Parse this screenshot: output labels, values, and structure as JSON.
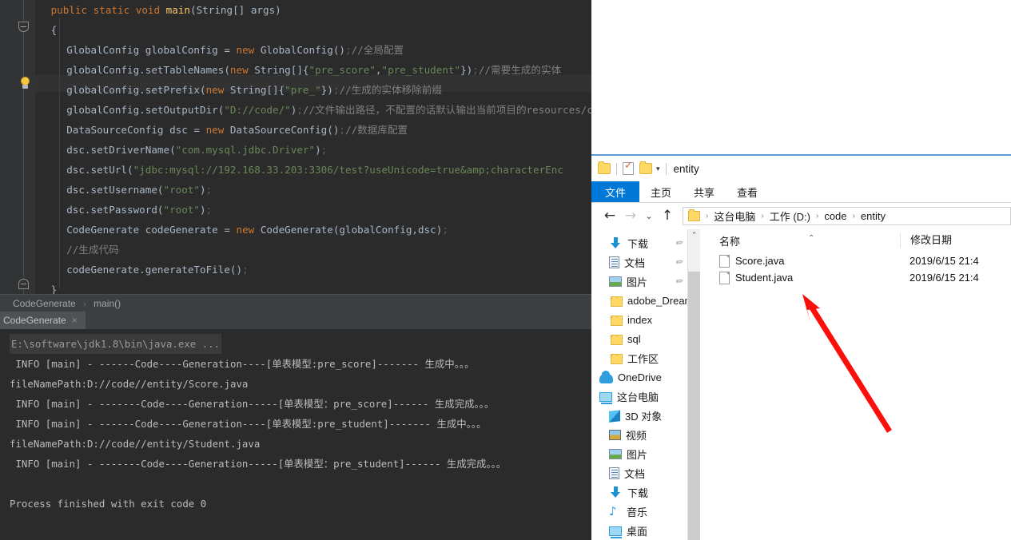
{
  "ide": {
    "code_lines": [
      [
        {
          "t": "kw",
          "s": "public static void "
        },
        {
          "t": "fn",
          "s": "main"
        },
        {
          "t": "pun",
          "s": "(String[] args)"
        }
      ],
      [
        {
          "t": "pun",
          "s": "{"
        }
      ],
      [
        {
          "t": "txt",
          "s": "GlobalConfig globalConfig = "
        },
        {
          "t": "kw",
          "s": "new "
        },
        {
          "t": "txt",
          "s": "GlobalConfig()"
        },
        {
          "t": "sem",
          "s": ";"
        },
        {
          "t": "cmt",
          "s": "//全局配置"
        }
      ],
      [
        {
          "t": "txt",
          "s": "globalConfig.setTableNames("
        },
        {
          "t": "kw",
          "s": "new "
        },
        {
          "t": "txt",
          "s": "String[]{"
        },
        {
          "t": "str",
          "s": "\"pre_score\""
        },
        {
          "t": "txt",
          "s": ","
        },
        {
          "t": "str",
          "s": "\"pre_student\""
        },
        {
          "t": "txt",
          "s": "})"
        },
        {
          "t": "sem",
          "s": ";"
        },
        {
          "t": "cmt",
          "s": "//需要生成的实体"
        }
      ],
      [
        {
          "t": "txt",
          "s": "globalConfig.setPrefix("
        },
        {
          "t": "kw",
          "s": "new "
        },
        {
          "t": "txt",
          "s": "String[]{"
        },
        {
          "t": "str",
          "s": "\"pre_\""
        },
        {
          "t": "txt",
          "s": "})"
        },
        {
          "t": "sem",
          "s": ";"
        },
        {
          "t": "cmt",
          "s": "//生成的实体移除前缀"
        }
      ],
      [
        {
          "t": "txt",
          "s": "globalConfig.setOutputDir("
        },
        {
          "t": "str",
          "s": "\"D://code/\""
        },
        {
          "t": "txt",
          "s": ")"
        },
        {
          "t": "sem",
          "s": ";"
        },
        {
          "t": "cmt",
          "s": "//文件输出路径，不配置的话默认输出当前项目的resources/code目录下"
        }
      ],
      [
        {
          "t": "txt",
          "s": "DataSourceConfig dsc = "
        },
        {
          "t": "kw",
          "s": "new "
        },
        {
          "t": "txt",
          "s": "DataSourceConfig()"
        },
        {
          "t": "sem",
          "s": ";"
        },
        {
          "t": "cmt",
          "s": "//数据库配置"
        }
      ],
      [
        {
          "t": "txt",
          "s": "dsc.setDriverName("
        },
        {
          "t": "str",
          "s": "\"com.mysql.jdbc.Driver\""
        },
        {
          "t": "txt",
          "s": ")"
        },
        {
          "t": "sem",
          "s": ";"
        }
      ],
      [
        {
          "t": "txt",
          "s": "dsc.setUrl("
        },
        {
          "t": "str",
          "s": "\"jdbc:mysql://192.168.33.203:3306/test?useUnicode=true&amp;characterEnc"
        }
      ],
      [
        {
          "t": "txt",
          "s": "dsc.setUsername("
        },
        {
          "t": "str",
          "s": "\"root\""
        },
        {
          "t": "txt",
          "s": ")"
        },
        {
          "t": "sem",
          "s": ";"
        }
      ],
      [
        {
          "t": "txt",
          "s": "dsc.setPassword("
        },
        {
          "t": "str",
          "s": "\"root\""
        },
        {
          "t": "txt",
          "s": ")"
        },
        {
          "t": "sem",
          "s": ";"
        }
      ],
      [
        {
          "t": "txt",
          "s": "CodeGenerate codeGenerate = "
        },
        {
          "t": "kw",
          "s": "new "
        },
        {
          "t": "txt",
          "s": "CodeGenerate(globalConfig,dsc)"
        },
        {
          "t": "sem",
          "s": ";"
        }
      ],
      [
        {
          "t": "cmt",
          "s": "//生成代码"
        }
      ],
      [
        {
          "t": "txt",
          "s": "codeGenerate.generateToFile()"
        },
        {
          "t": "sem",
          "s": ";"
        }
      ],
      [
        {
          "t": "pun",
          "s": "}"
        }
      ]
    ],
    "breadcrumb": {
      "class_name": "CodeGenerate",
      "separator": "›",
      "method_name": "main()"
    },
    "console_tab": {
      "label": "CodeGenerate",
      "close_icon": "×"
    },
    "console_lines": [
      {
        "type": "cmd",
        "text": "E:\\software\\jdk1.8\\bin\\java.exe ..."
      },
      {
        "type": "log",
        "text": " INFO [main] - ------Code----Generation----[单表模型:pre_score]------- 生成中。。。"
      },
      {
        "type": "log",
        "text": "fileNamePath:D://code//entity/Score.java"
      },
      {
        "type": "log",
        "text": " INFO [main] - -------Code----Generation-----[单表模型：pre_score]------ 生成完成。。。"
      },
      {
        "type": "log",
        "text": " INFO [main] - ------Code----Generation----[单表模型:pre_student]------- 生成中。。。"
      },
      {
        "type": "log",
        "text": "fileNamePath:D://code//entity/Student.java"
      },
      {
        "type": "log",
        "text": " INFO [main] - -------Code----Generation-----[单表模型：pre_student]------ 生成完成。。。"
      },
      {
        "type": "blank",
        "text": ""
      },
      {
        "type": "log",
        "text": "Process finished with exit code 0"
      }
    ]
  },
  "explorer": {
    "title": "entity",
    "quick_access": [
      {
        "icon": "folder-icon",
        "name": "quick-access-folder"
      },
      {
        "icon": "properties-icon",
        "name": "quick-access-properties"
      },
      {
        "icon": "new-folder-icon",
        "name": "quick-access-new-folder"
      }
    ],
    "dropdown_icon": "▾",
    "ribbon_tabs": [
      {
        "label": "文件",
        "active": true
      },
      {
        "label": "主页",
        "active": false
      },
      {
        "label": "共享",
        "active": false
      },
      {
        "label": "查看",
        "active": false
      }
    ],
    "nav_buttons": {
      "back": "←",
      "forward": "→",
      "history": "⌄",
      "up": "↑"
    },
    "breadcrumbs": [
      "这台电脑",
      "工作 (D:)",
      "code",
      "entity"
    ],
    "breadcrumb_sep": "›",
    "nav_pane": [
      {
        "label": "下载",
        "icon": "download-icon",
        "indent": 1,
        "pinned": true
      },
      {
        "label": "文档",
        "icon": "documents-icon",
        "indent": 1,
        "pinned": true
      },
      {
        "label": "图片",
        "icon": "pictures-icon",
        "indent": 1,
        "pinned": true
      },
      {
        "label": "adobe_Dreamw",
        "icon": "folder-icon",
        "indent": 2,
        "pinned": false
      },
      {
        "label": "index",
        "icon": "folder-icon",
        "indent": 2,
        "pinned": false
      },
      {
        "label": "sql",
        "icon": "folder-icon",
        "indent": 2,
        "pinned": false
      },
      {
        "label": "工作区",
        "icon": "folder-icon",
        "indent": 2,
        "pinned": false
      },
      {
        "label": "OneDrive",
        "icon": "onedrive-cloud-icon",
        "indent": 0,
        "pinned": false
      },
      {
        "label": "这台电脑",
        "icon": "this-pc-icon",
        "indent": 0,
        "pinned": false
      },
      {
        "label": "3D 对象",
        "icon": "3d-objects-icon",
        "indent": 1,
        "pinned": false
      },
      {
        "label": "视频",
        "icon": "videos-icon",
        "indent": 1,
        "pinned": false
      },
      {
        "label": "图片",
        "icon": "pictures-icon",
        "indent": 1,
        "pinned": false
      },
      {
        "label": "文档",
        "icon": "documents-icon",
        "indent": 1,
        "pinned": false
      },
      {
        "label": "下载",
        "icon": "download-icon",
        "indent": 1,
        "pinned": false
      },
      {
        "label": "音乐",
        "icon": "music-icon",
        "indent": 1,
        "pinned": false
      },
      {
        "label": "桌面",
        "icon": "desktop-icon",
        "indent": 1,
        "pinned": false
      }
    ],
    "columns": {
      "name": "名称",
      "date": "修改日期",
      "sort_caret": "⌃"
    },
    "files": [
      {
        "name": "Score.java",
        "date": "2019/6/15 21:4",
        "icon": "file-icon"
      },
      {
        "name": "Student.java",
        "date": "2019/6/15 21:4",
        "icon": "file-icon"
      }
    ],
    "scrollbar": {
      "up_arrow": "⌃"
    }
  },
  "annotation": {
    "arrow_color": "#fa0f0a",
    "name": "red-arrow-annotation"
  }
}
